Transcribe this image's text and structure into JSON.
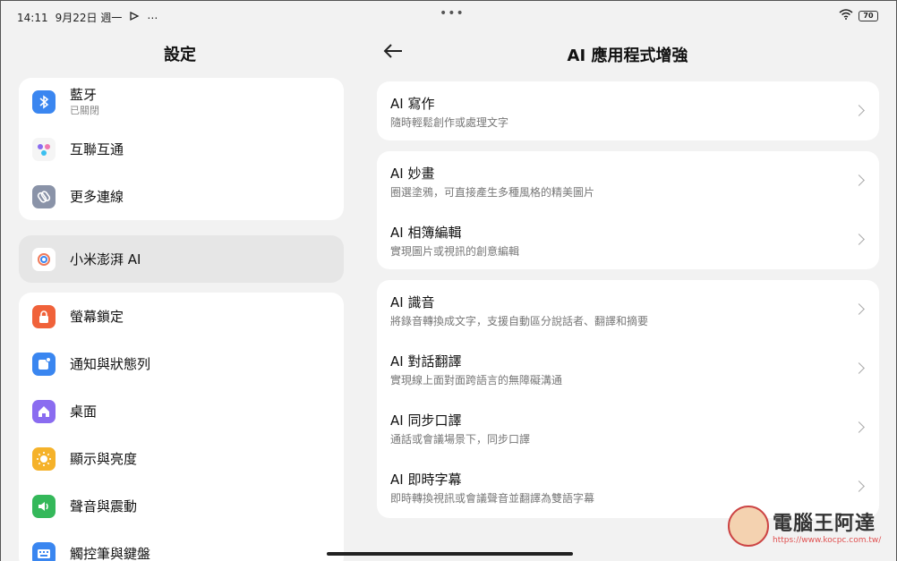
{
  "status": {
    "time": "14:11",
    "date": "9月22日 週一",
    "battery": "70"
  },
  "left": {
    "title": "設定",
    "group1": [
      {
        "label": "藍牙",
        "sub": "已關閉",
        "icon": "bluetooth-icon",
        "color": "#3a86f0"
      },
      {
        "label": "互聯互通",
        "icon": "connect-dots-icon",
        "color": "#f5f5f5"
      },
      {
        "label": "更多連線",
        "icon": "link-icon",
        "color": "#8a93a8"
      }
    ],
    "ai_item": {
      "label": "小米澎湃 AI",
      "icon": "hyperai-icon"
    },
    "group2": [
      {
        "label": "螢幕鎖定",
        "icon": "lock-icon",
        "color": "#f0623a"
      },
      {
        "label": "通知與狀態列",
        "icon": "notification-icon",
        "color": "#3a86f0"
      },
      {
        "label": "桌面",
        "icon": "home-icon",
        "color": "#8a6cf0"
      },
      {
        "label": "顯示與亮度",
        "icon": "sun-icon",
        "color": "#f5b22a"
      },
      {
        "label": "聲音與震動",
        "icon": "speaker-icon",
        "color": "#34b85a"
      },
      {
        "label": "觸控筆與鍵盤",
        "icon": "keyboard-icon",
        "color": "#3a86f0"
      }
    ]
  },
  "right": {
    "title": "AI 應用程式增強",
    "card1": [
      {
        "title": "AI 寫作",
        "sub": "隨時輕鬆創作或處理文字"
      }
    ],
    "card2": [
      {
        "title": "AI 妙畫",
        "sub": "圈選塗鴉，可直接產生多種風格的精美圖片"
      },
      {
        "title": "AI 相簿編輯",
        "sub": "實現圖片或視訊的創意編輯"
      }
    ],
    "card3": [
      {
        "title": "AI 識音",
        "sub": "將錄音轉換成文字，支援自動區分說話者、翻譯和摘要"
      },
      {
        "title": "AI 對話翻譯",
        "sub": "實現線上面對面跨語言的無障礙溝通"
      },
      {
        "title": "AI 同步口譯",
        "sub": "通話或會議場景下，同步口譯"
      },
      {
        "title": "AI 即時字幕",
        "sub": "即時轉換視訊或會議聲音並翻譯為雙語字幕"
      }
    ]
  },
  "watermark": {
    "name": "電腦王阿達",
    "url": "https://www.kocpc.com.tw/"
  }
}
